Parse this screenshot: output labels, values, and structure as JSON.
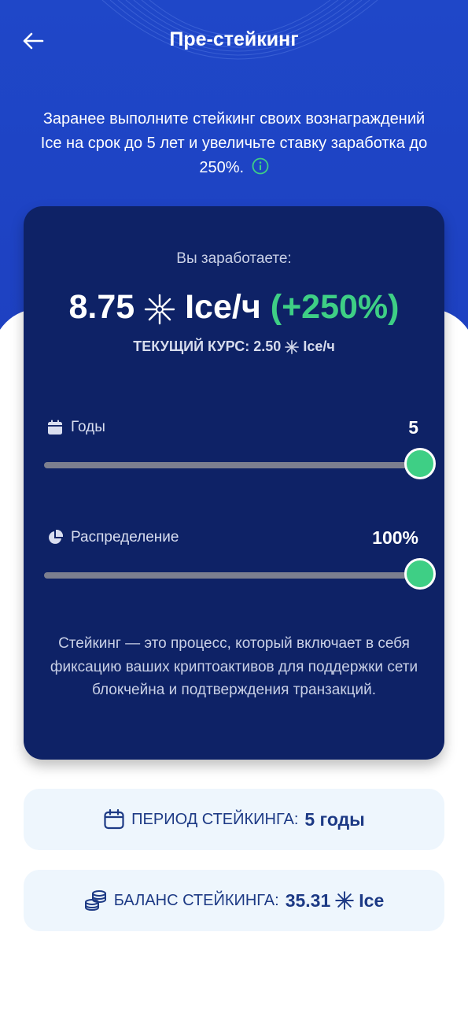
{
  "header": {
    "title": "Пре-стейкинг",
    "back_icon": "arrow-left-icon"
  },
  "intro": {
    "text": "Заранее выполните стейкинг своих вознаграждений Ice на срок до 5 лет и увеличьте ставку заработка до 250%.",
    "info_icon": "info-icon"
  },
  "card": {
    "earn_label": "Вы заработаете:",
    "earn_amount": "8.75",
    "earn_unit": "Ice/ч",
    "earn_percent": "(+250%)",
    "rate_label": "ТЕКУЩИЙ КУРС: 2.50",
    "rate_unit": "Ice/ч",
    "years": {
      "label": "Годы",
      "value": "5",
      "icon": "calendar-icon",
      "level": 1.0
    },
    "distribution": {
      "label": "Распределение",
      "value": "100%",
      "icon": "pie-chart-icon",
      "level": 1.0
    },
    "description": "Стейкинг — это процесс, который включает в себя фиксацию ваших криптоактивов для поддержки сети блокчейна и подтверждения транзакций."
  },
  "period_pill": {
    "label": "ПЕРИОД СТЕЙКИНГА:",
    "value": "5 годы",
    "icon": "calendar-icon"
  },
  "balance_pill": {
    "label": "БАЛАНС СТЕЙКИНГА:",
    "value": "35.31",
    "unit": "Ice",
    "icon": "coins-icon"
  },
  "colors": {
    "hero_blue": "#1f47c8",
    "card_navy": "#0e2266",
    "accent_green": "#3ecf85",
    "pill_bg": "#eef6fd",
    "pill_text": "#1d3a85"
  }
}
